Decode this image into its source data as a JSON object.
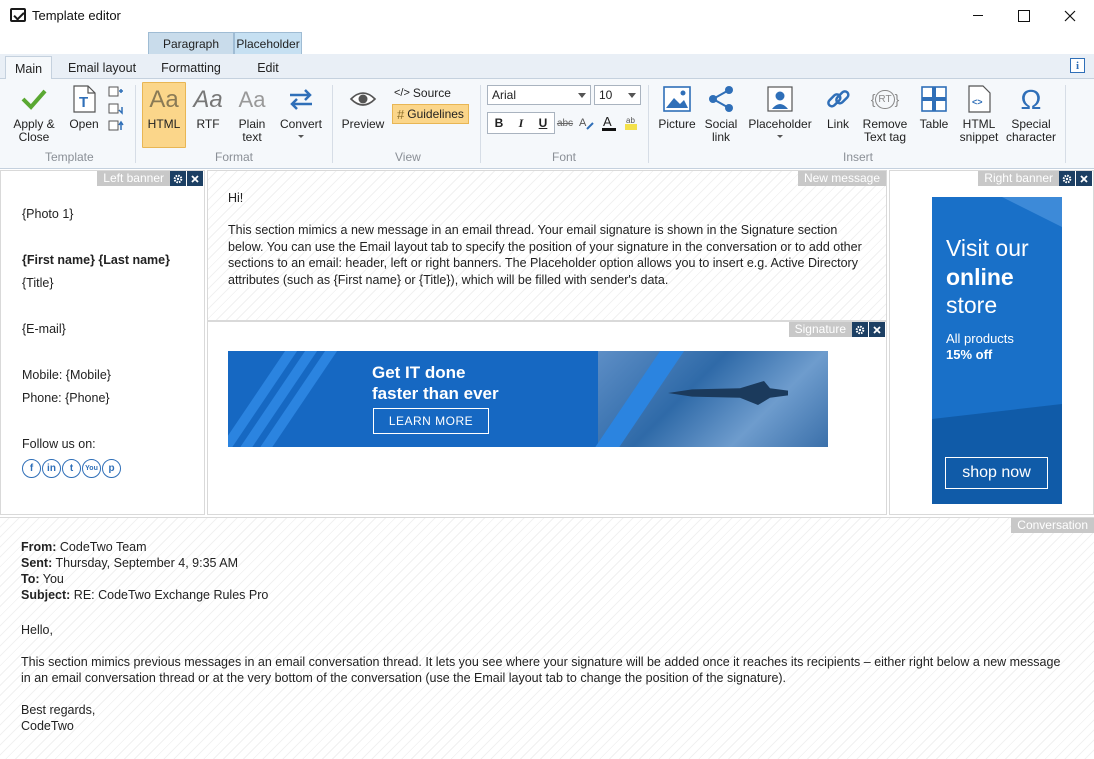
{
  "window": {
    "title": "Template editor"
  },
  "context_groups": {
    "paragraph": "Paragraph",
    "placeholder": "Placeholder"
  },
  "tabs": {
    "main": "Main",
    "email_layout": "Email layout",
    "formatting": "Formatting",
    "edit": "Edit",
    "active": "Main"
  },
  "ribbon": {
    "template": {
      "label": "Template",
      "apply_close": "Apply &\nClose",
      "open": "Open"
    },
    "format": {
      "label": "Format",
      "html": "HTML",
      "rtf": "RTF",
      "plain_text": "Plain\ntext",
      "convert": "Convert",
      "selected": "HTML"
    },
    "view": {
      "label": "View",
      "preview": "Preview",
      "source": "Source",
      "guidelines": "Guidelines"
    },
    "font": {
      "label": "Font",
      "family": "Arial",
      "size": "10",
      "bold": "B",
      "italic": "I",
      "underline": "U",
      "strike": "abc"
    },
    "insert": {
      "label": "Insert",
      "picture": "Picture",
      "social_link": "Social\nlink",
      "placeholder": "Placeholder",
      "link": "Link",
      "remove_text_tag": "Remove\nText tag",
      "table": "Table",
      "html_snippet": "HTML\nsnippet",
      "special_character": "Special\ncharacter"
    }
  },
  "left_banner": {
    "tag": "Left banner",
    "photo": "{Photo 1}",
    "name": "{First name} {Last name}",
    "title": "{Title}",
    "email": "{E-mail}",
    "mobile": "Mobile: {Mobile}",
    "phone": "Phone: {Phone}",
    "follow": "Follow us on:",
    "social_icons": [
      "facebook-icon",
      "linkedin-icon",
      "twitter-icon",
      "youtube-icon",
      "pinterest-icon"
    ],
    "social_glyphs": [
      "f",
      "in",
      "t",
      "You",
      "p"
    ]
  },
  "new_message": {
    "tag": "New message",
    "greeting": "Hi!",
    "body": "This section mimics a new message in an email thread. Your email signature is shown in the Signature section below. You can use the Email layout tab to specify the position of your signature in the conversation or to add other sections to an email: header, left or right banners. The Placeholder option allows you to insert e.g. Active Directory attributes (such as {First name} or {Title}), which will be filled with sender's data."
  },
  "signature": {
    "tag": "Signature",
    "banner_headline": "Get IT done\nfaster than ever",
    "banner_button": "LEARN MORE"
  },
  "right_banner": {
    "tag": "Right banner",
    "ad_line1": "Visit our",
    "ad_line2": "online",
    "ad_line3": "store",
    "ad_sub1": "All products",
    "ad_sub2": "15% off",
    "ad_button": "shop now"
  },
  "conversation": {
    "tag": "Conversation",
    "from_label": "From:",
    "from": "CodeTwo Team",
    "sent_label": "Sent:",
    "sent": "Thursday, September 4, 9:35 AM",
    "to_label": "To:",
    "to": "You",
    "subject_label": "Subject:",
    "subject": "RE: CodeTwo Exchange Rules Pro",
    "hello": "Hello,",
    "body": "This section mimics previous messages in an email conversation thread. It lets you see where your signature will be added once it reaches its recipients – either right below a new message in an email conversation thread or at the very bottom of the conversation (use the Email layout tab to change the position of the signature).",
    "regards": "Best regards,",
    "sender": "CodeTwo"
  },
  "colors": {
    "accent": "#2f6fb8",
    "selected": "#fbd68a",
    "banner_blue": "#1668c2",
    "panel_button": "#1c3f63"
  }
}
